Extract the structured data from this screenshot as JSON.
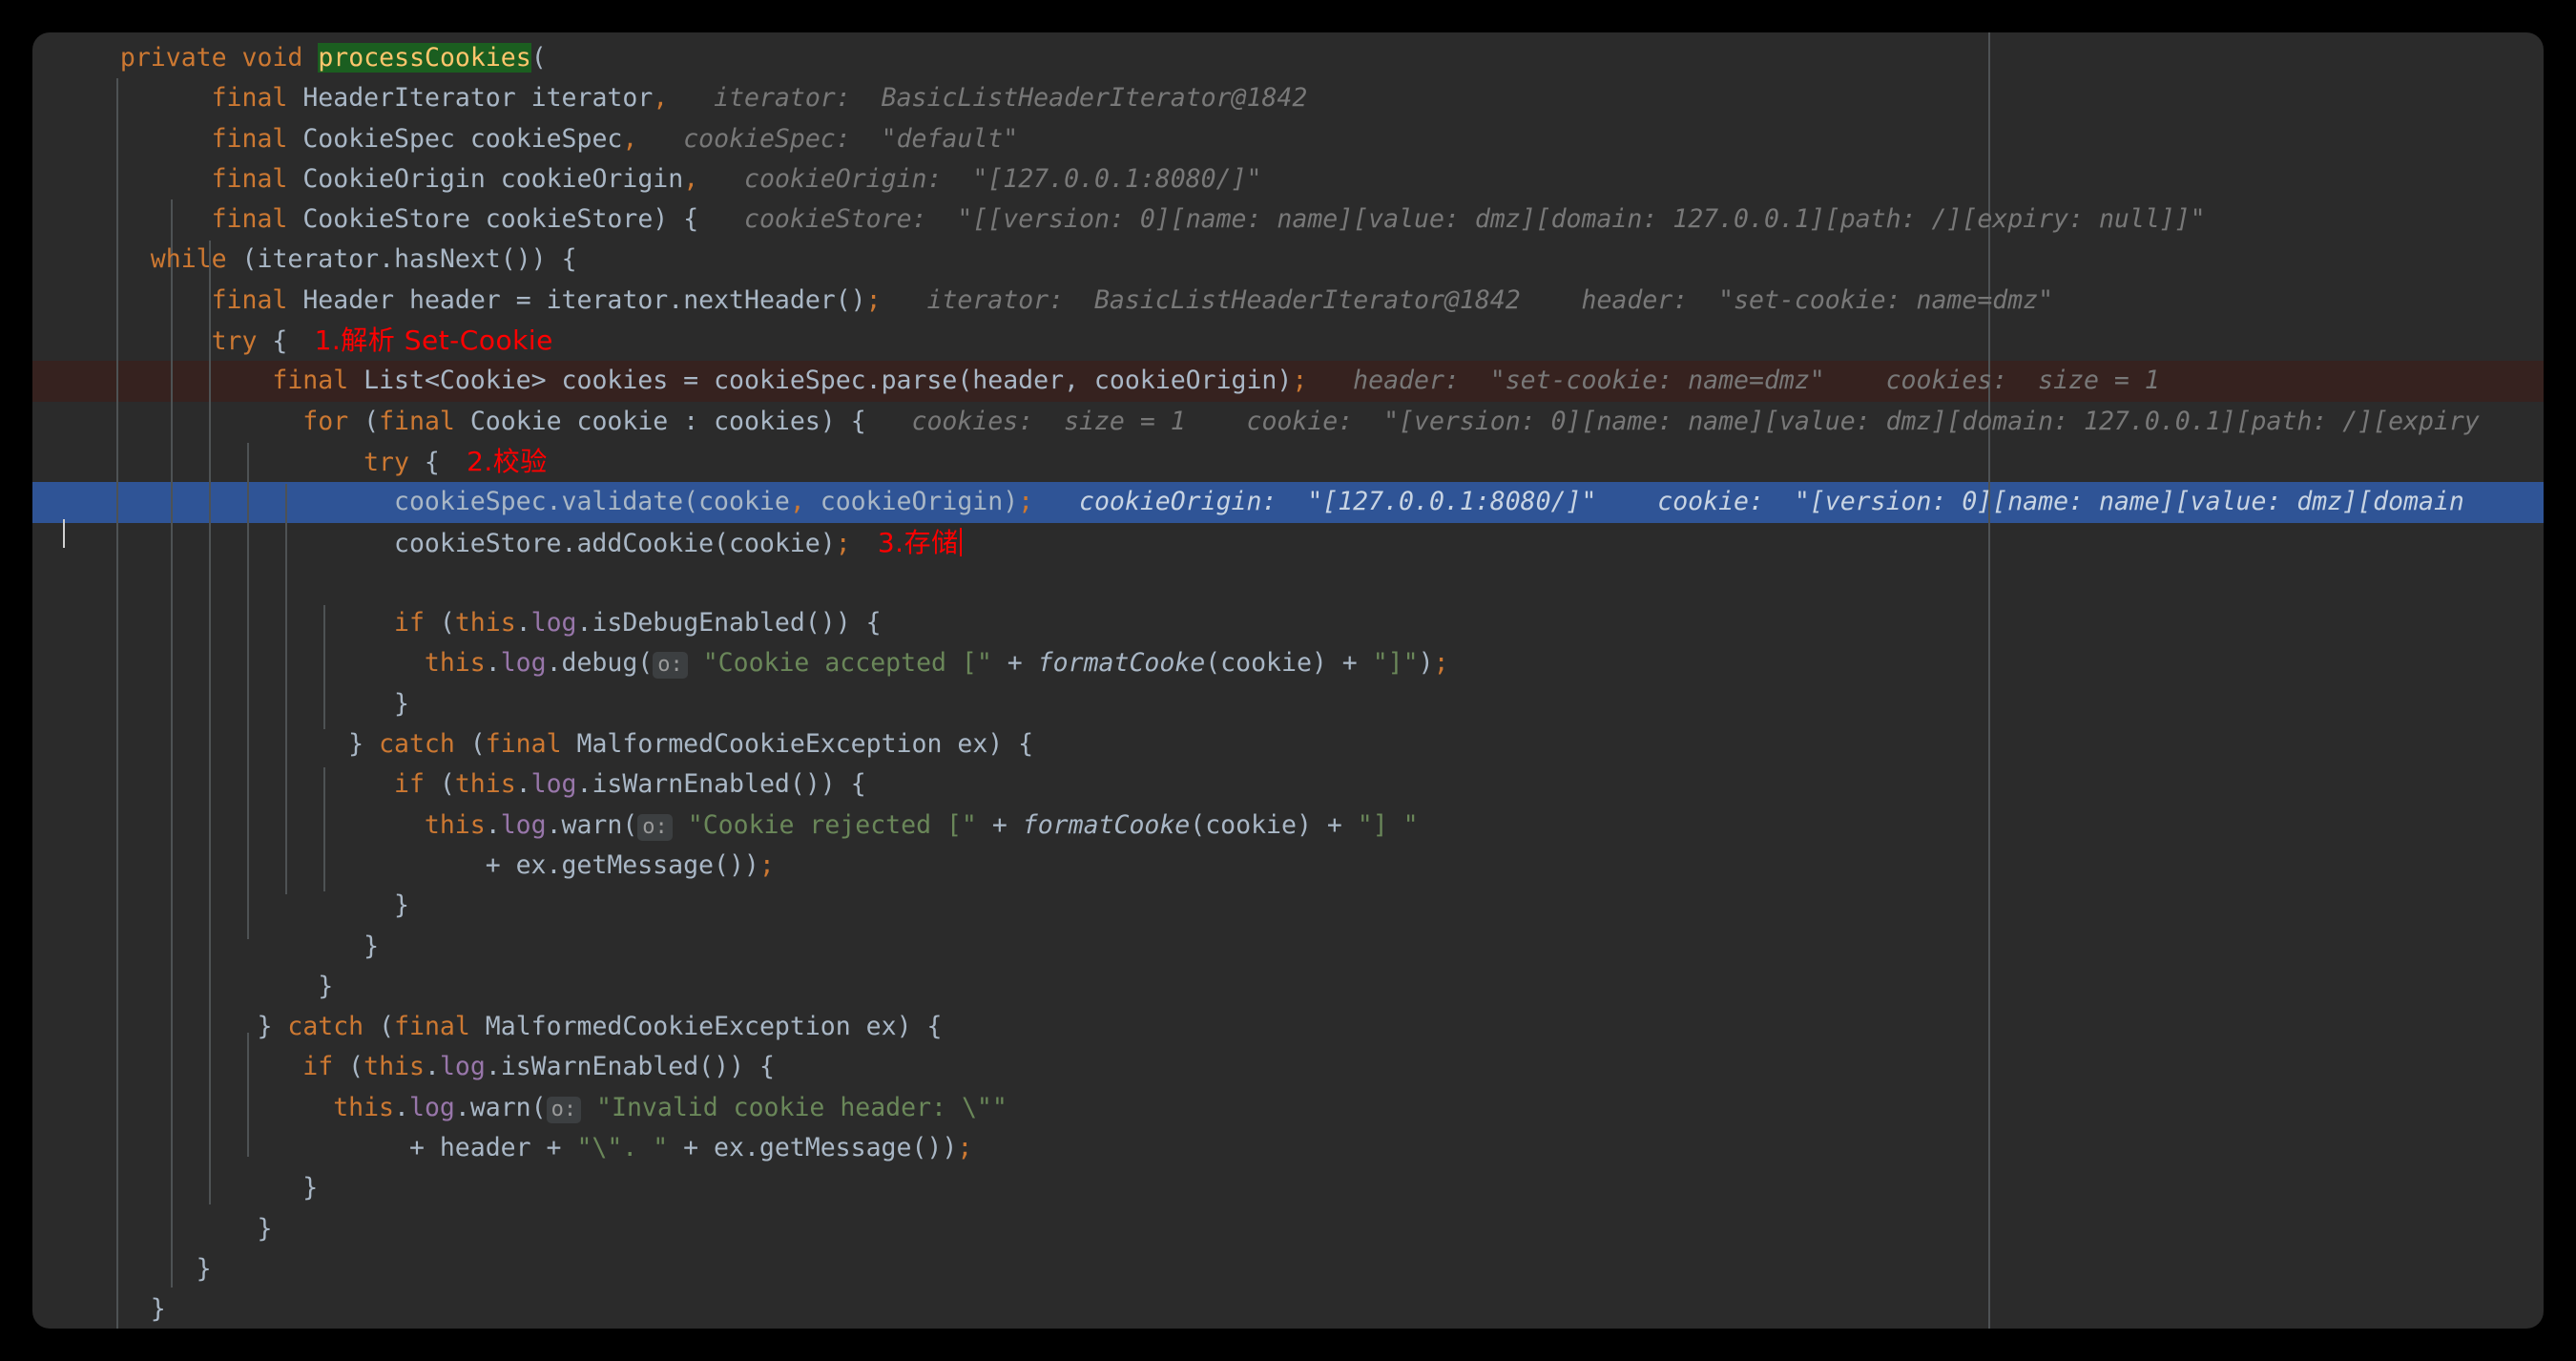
{
  "editor": {
    "language": "java",
    "theme": "darcula",
    "colors": {
      "background": "#2b2b2b",
      "page_background": "#000000",
      "default_text": "#a9b7c6",
      "keyword": "#cc7832",
      "string": "#6a8759",
      "number": "#6897bb",
      "field": "#9876aa",
      "method_declaration": "#ffc66d",
      "inlay_hint": "#787878",
      "execution_point_row": "#36221f",
      "selection_row": "#2f5496",
      "annotation_red": "#ff0000",
      "search_match_highlight": "#1b5e20",
      "indent_guide": "#4e5254"
    },
    "lines": [
      {
        "n": 1,
        "indent": 2,
        "tokens": [
          {
            "t": "private",
            "c": "kw"
          },
          {
            "t": " ",
            "c": "id"
          },
          {
            "t": "void",
            "c": "kw"
          },
          {
            "t": " ",
            "c": "id"
          },
          {
            "t": "processCookies",
            "c": "fnhl"
          },
          {
            "t": "(",
            "c": "id"
          }
        ]
      },
      {
        "n": 2,
        "indent": 8,
        "tokens": [
          {
            "t": "final",
            "c": "kw"
          },
          {
            "t": " HeaderIterator iterator",
            "c": "id"
          },
          {
            "t": ",",
            "c": "kw"
          }
        ],
        "hints": [
          {
            "label": "iterator:",
            "value": "BasicListHeaderIterator@1842"
          }
        ]
      },
      {
        "n": 3,
        "indent": 8,
        "tokens": [
          {
            "t": "final",
            "c": "kw"
          },
          {
            "t": " CookieSpec cookieSpec",
            "c": "id"
          },
          {
            "t": ",",
            "c": "kw"
          }
        ],
        "hints": [
          {
            "label": "cookieSpec:",
            "value": "\"default\""
          }
        ]
      },
      {
        "n": 4,
        "indent": 8,
        "tokens": [
          {
            "t": "final",
            "c": "kw"
          },
          {
            "t": " CookieOrigin cookieOrigin",
            "c": "id"
          },
          {
            "t": ",",
            "c": "kw"
          }
        ],
        "hints": [
          {
            "label": "cookieOrigin:",
            "value": "\"[127.0.0.1:8080/]\""
          }
        ]
      },
      {
        "n": 5,
        "indent": 8,
        "tokens": [
          {
            "t": "final",
            "c": "kw"
          },
          {
            "t": " CookieStore cookieStore) {",
            "c": "id"
          }
        ],
        "hints": [
          {
            "label": "cookieStore:",
            "value": "\"[[version: 0][name: name][value: dmz][domain: 127.0.0.1][path: /][expiry: null]]\""
          }
        ]
      },
      {
        "n": 6,
        "indent": 4,
        "tokens": [
          {
            "t": "while",
            "c": "kw"
          },
          {
            "t": " (iterator.hasNext()) {",
            "c": "id"
          }
        ]
      },
      {
        "n": 7,
        "indent": 8,
        "tokens": [
          {
            "t": "final",
            "c": "kw"
          },
          {
            "t": " Header header = iterator.nextHeader()",
            "c": "id"
          },
          {
            "t": ";",
            "c": "kw"
          }
        ],
        "hints": [
          {
            "label": "iterator:",
            "value": "BasicListHeaderIterator@1842"
          },
          {
            "label": "header:",
            "value": "\"set-cookie: name=dmz\""
          }
        ]
      },
      {
        "n": 8,
        "indent": 8,
        "tokens": [
          {
            "t": "try",
            "c": "kw"
          },
          {
            "t": " {",
            "c": "id"
          }
        ],
        "annotation": "1.解析 Set-Cookie"
      },
      {
        "n": 9,
        "indent": 12,
        "row_state": "execution-point",
        "tokens": [
          {
            "t": "final",
            "c": "kw"
          },
          {
            "t": " List<Cookie> cookies = cookieSpec.parse(header, cookieOrigin)",
            "c": "id"
          },
          {
            "t": ";",
            "c": "kw"
          }
        ],
        "hints": [
          {
            "label": "header:",
            "value": "\"set-cookie: name=dmz\""
          },
          {
            "label": "cookies:",
            "value": "size = 1"
          }
        ]
      },
      {
        "n": 10,
        "indent": 14,
        "tokens": [
          {
            "t": "for",
            "c": "kw"
          },
          {
            "t": " (",
            "c": "id"
          },
          {
            "t": "final",
            "c": "kw"
          },
          {
            "t": " Cookie cookie : cookies) {",
            "c": "id"
          }
        ],
        "hints": [
          {
            "label": "cookies:",
            "value": "size = 1"
          },
          {
            "label": "cookie:",
            "value": "\"[version: 0][name: name][value: dmz][domain: 127.0.0.1][path: /][expiry"
          }
        ]
      },
      {
        "n": 11,
        "indent": 18,
        "tokens": [
          {
            "t": "try",
            "c": "kw"
          },
          {
            "t": " {",
            "c": "id"
          }
        ],
        "annotation": "2.校验"
      },
      {
        "n": 12,
        "indent": 20,
        "row_state": "selected",
        "tokens": [
          {
            "t": "cookieSpec.validate(cookie",
            "c": "id"
          },
          {
            "t": ",",
            "c": "kw"
          },
          {
            "t": " cookieOrigin)",
            "c": "id"
          },
          {
            "t": ";",
            "c": "kw"
          }
        ],
        "hints": [
          {
            "label": "cookieOrigin:",
            "value": "\"[127.0.0.1:8080/]\""
          },
          {
            "label": "cookie:",
            "value": "\"[version: 0][name: name][value: dmz][domain"
          }
        ]
      },
      {
        "n": 13,
        "indent": 20,
        "tokens": [
          {
            "t": "cookieStore.addCookie(cookie)",
            "c": "id"
          },
          {
            "t": ";",
            "c": "kw"
          }
        ],
        "annotation": "3.存储",
        "caret": true
      },
      {
        "n": 14,
        "indent": 0,
        "tokens": []
      },
      {
        "n": 15,
        "indent": 20,
        "tokens": [
          {
            "t": "if",
            "c": "kw"
          },
          {
            "t": " (",
            "c": "id"
          },
          {
            "t": "this",
            "c": "kw"
          },
          {
            "t": ".",
            "c": "id"
          },
          {
            "t": "log",
            "c": "fld"
          },
          {
            "t": ".isDebugEnabled()) {",
            "c": "id"
          }
        ]
      },
      {
        "n": 16,
        "indent": 22,
        "tokens": [
          {
            "t": "this",
            "c": "kw"
          },
          {
            "t": ".",
            "c": "id"
          },
          {
            "t": "log",
            "c": "fld"
          },
          {
            "t": ".debug(",
            "c": "id"
          }
        ],
        "param_hint": "o:",
        "tokens2": [
          {
            "t": " \"Cookie accepted [\"",
            "c": "str"
          },
          {
            "t": " + ",
            "c": "id"
          },
          {
            "t": "formatCooke",
            "c": "ital"
          },
          {
            "t": "(cookie) + ",
            "c": "id"
          },
          {
            "t": "\"]\"",
            "c": "str"
          },
          {
            "t": ")",
            "c": "id"
          },
          {
            "t": ";",
            "c": "kw"
          }
        ]
      },
      {
        "n": 17,
        "indent": 20,
        "tokens": [
          {
            "t": "}",
            "c": "id"
          }
        ]
      },
      {
        "n": 18,
        "indent": 17,
        "tokens": [
          {
            "t": "} ",
            "c": "id"
          },
          {
            "t": "catch",
            "c": "kw"
          },
          {
            "t": " (",
            "c": "id"
          },
          {
            "t": "final",
            "c": "kw"
          },
          {
            "t": " MalformedCookieException ex) {",
            "c": "id"
          }
        ]
      },
      {
        "n": 19,
        "indent": 20,
        "tokens": [
          {
            "t": "if",
            "c": "kw"
          },
          {
            "t": " (",
            "c": "id"
          },
          {
            "t": "this",
            "c": "kw"
          },
          {
            "t": ".",
            "c": "id"
          },
          {
            "t": "log",
            "c": "fld"
          },
          {
            "t": ".isWarnEnabled()) {",
            "c": "id"
          }
        ]
      },
      {
        "n": 20,
        "indent": 22,
        "tokens": [
          {
            "t": "this",
            "c": "kw"
          },
          {
            "t": ".",
            "c": "id"
          },
          {
            "t": "log",
            "c": "fld"
          },
          {
            "t": ".warn(",
            "c": "id"
          }
        ],
        "param_hint": "o:",
        "tokens2": [
          {
            "t": " \"Cookie rejected [\"",
            "c": "str"
          },
          {
            "t": " + ",
            "c": "id"
          },
          {
            "t": "formatCooke",
            "c": "ital"
          },
          {
            "t": "(cookie) + ",
            "c": "id"
          },
          {
            "t": "\"] \"",
            "c": "str"
          }
        ]
      },
      {
        "n": 21,
        "indent": 26,
        "tokens": [
          {
            "t": "+ ex.getMessage())",
            "c": "id"
          },
          {
            "t": ";",
            "c": "kw"
          }
        ]
      },
      {
        "n": 22,
        "indent": 20,
        "tokens": [
          {
            "t": "}",
            "c": "id"
          }
        ]
      },
      {
        "n": 23,
        "indent": 18,
        "tokens": [
          {
            "t": "}",
            "c": "id"
          }
        ]
      },
      {
        "n": 24,
        "indent": 15,
        "tokens": [
          {
            "t": "}",
            "c": "id"
          }
        ]
      },
      {
        "n": 25,
        "indent": 11,
        "tokens": [
          {
            "t": "} ",
            "c": "id"
          },
          {
            "t": "catch",
            "c": "kw"
          },
          {
            "t": " (",
            "c": "id"
          },
          {
            "t": "final",
            "c": "kw"
          },
          {
            "t": " MalformedCookieException ex) {",
            "c": "id"
          }
        ]
      },
      {
        "n": 26,
        "indent": 14,
        "tokens": [
          {
            "t": "if",
            "c": "kw"
          },
          {
            "t": " (",
            "c": "id"
          },
          {
            "t": "this",
            "c": "kw"
          },
          {
            "t": ".",
            "c": "id"
          },
          {
            "t": "log",
            "c": "fld"
          },
          {
            "t": ".isWarnEnabled()) {",
            "c": "id"
          }
        ]
      },
      {
        "n": 27,
        "indent": 16,
        "tokens": [
          {
            "t": "this",
            "c": "kw"
          },
          {
            "t": ".",
            "c": "id"
          },
          {
            "t": "log",
            "c": "fld"
          },
          {
            "t": ".warn(",
            "c": "id"
          }
        ],
        "param_hint": "o:",
        "tokens2": [
          {
            "t": " \"Invalid cookie header: \\\"\"",
            "c": "str"
          }
        ]
      },
      {
        "n": 28,
        "indent": 21,
        "tokens": [
          {
            "t": "+ header + ",
            "c": "id"
          },
          {
            "t": "\"\\\". \"",
            "c": "str"
          },
          {
            "t": " + ex.getMessage())",
            "c": "id"
          },
          {
            "t": ";",
            "c": "kw"
          }
        ]
      },
      {
        "n": 29,
        "indent": 14,
        "tokens": [
          {
            "t": "}",
            "c": "id"
          }
        ]
      },
      {
        "n": 30,
        "indent": 11,
        "tokens": [
          {
            "t": "}",
            "c": "id"
          }
        ]
      },
      {
        "n": 31,
        "indent": 7,
        "tokens": [
          {
            "t": "}",
            "c": "id"
          }
        ]
      },
      {
        "n": 32,
        "indent": 4,
        "tokens": [
          {
            "t": "}",
            "c": "id"
          }
        ]
      }
    ]
  }
}
